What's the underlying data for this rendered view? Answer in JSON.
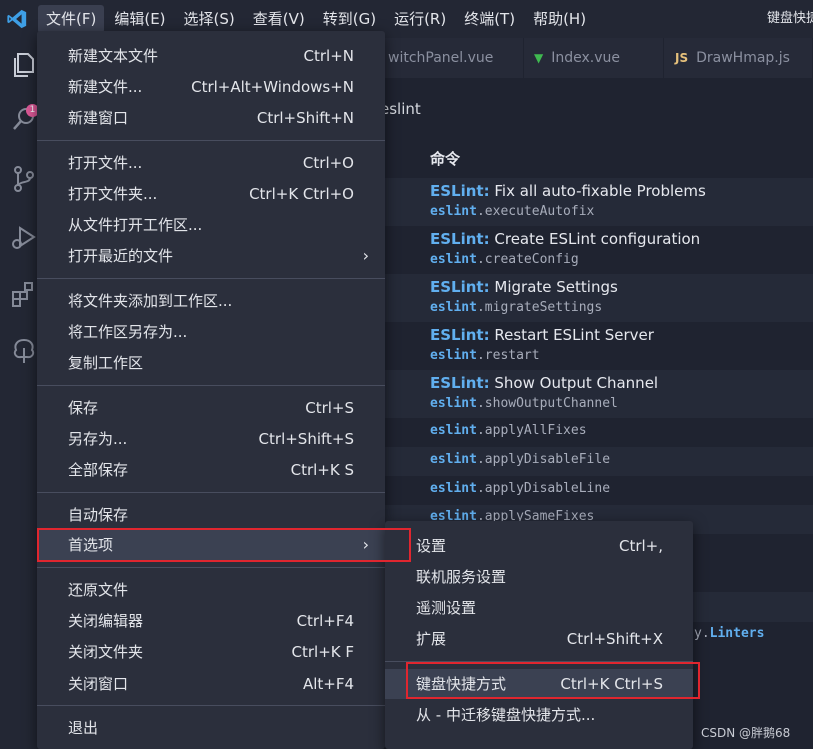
{
  "menubar": {
    "items": [
      "文件(F)",
      "编辑(E)",
      "选择(S)",
      "查看(V)",
      "转到(G)",
      "运行(R)",
      "终端(T)",
      "帮助(H)"
    ],
    "window_title": "键盘快捷"
  },
  "activity": {
    "explorer_badge": "1"
  },
  "tabs": [
    {
      "label": "witchPanel.vue",
      "icon": "vue-icon"
    },
    {
      "label": "Index.vue",
      "icon": "vue-icon"
    },
    {
      "label": "DrawHmap.js",
      "icon_text": "JS"
    }
  ],
  "breadcrumb": "eslint",
  "commands": {
    "header": "命令",
    "rows": [
      {
        "prefix": "ESLint:",
        "title": "Fix all auto-fixable Problems",
        "ns": "eslint",
        "id": ".executeAutofix"
      },
      {
        "prefix": "ESLint:",
        "title": "Create ESLint configuration",
        "ns": "eslint",
        "id": ".createConfig"
      },
      {
        "prefix": "ESLint:",
        "title": "Migrate Settings",
        "ns": "eslint",
        "id": ".migrateSettings"
      },
      {
        "prefix": "ESLint:",
        "title": "Restart ESLint Server",
        "ns": "eslint",
        "id": ".restart"
      },
      {
        "prefix": "ESLint:",
        "title": "Show Output Channel",
        "ns": "eslint",
        "id": ".showOutputChannel"
      }
    ],
    "id_rows": [
      {
        "ns": "eslint",
        "id": ".applyAllFixes"
      },
      {
        "ns": "eslint",
        "id": ".applyDisableFile"
      },
      {
        "ns": "eslint",
        "id": ".applyDisableLine"
      },
      {
        "ns": "eslint",
        "id": ".applySameFixes"
      }
    ],
    "stray_text": "y.",
    "stray_bold": "Linters"
  },
  "file_menu": {
    "groups": [
      [
        {
          "label": "新建文本文件",
          "key": "Ctrl+N"
        },
        {
          "label": "新建文件...",
          "key": "Ctrl+Alt+Windows+N"
        },
        {
          "label": "新建窗口",
          "key": "Ctrl+Shift+N"
        }
      ],
      [
        {
          "label": "打开文件...",
          "key": "Ctrl+O"
        },
        {
          "label": "打开文件夹...",
          "key": "Ctrl+K Ctrl+O"
        },
        {
          "label": "从文件打开工作区...",
          "key": ""
        },
        {
          "label": "打开最近的文件",
          "key": "",
          "submenu": true
        }
      ],
      [
        {
          "label": "将文件夹添加到工作区...",
          "key": ""
        },
        {
          "label": "将工作区另存为...",
          "key": ""
        },
        {
          "label": "复制工作区",
          "key": ""
        }
      ],
      [
        {
          "label": "保存",
          "key": "Ctrl+S"
        },
        {
          "label": "另存为...",
          "key": "Ctrl+Shift+S"
        },
        {
          "label": "全部保存",
          "key": "Ctrl+K S"
        }
      ],
      [
        {
          "label": "自动保存",
          "key": ""
        },
        {
          "label": "首选项",
          "key": "",
          "submenu": true,
          "highlighted": true
        }
      ],
      [
        {
          "label": "还原文件",
          "key": ""
        },
        {
          "label": "关闭编辑器",
          "key": "Ctrl+F4"
        },
        {
          "label": "关闭文件夹",
          "key": "Ctrl+K F"
        },
        {
          "label": "关闭窗口",
          "key": "Alt+F4"
        }
      ],
      [
        {
          "label": "退出",
          "key": ""
        }
      ]
    ]
  },
  "preferences_menu": {
    "items": [
      {
        "label": "设置",
        "key": "Ctrl+,"
      },
      {
        "label": "联机服务设置",
        "key": ""
      },
      {
        "label": "遥测设置",
        "key": ""
      },
      {
        "label": "扩展",
        "key": "Ctrl+Shift+X"
      },
      {
        "label": "键盘快捷方式",
        "key": "Ctrl+K Ctrl+S",
        "highlighted": true
      },
      {
        "label": "从 - 中迁移键盘快捷方式...",
        "key": ""
      }
    ]
  },
  "watermark": "CSDN @胖鹅68",
  "colors": {
    "accent": "#61afef",
    "highlight_box": "#e0262f",
    "menu_bg": "#2b2f3c"
  }
}
